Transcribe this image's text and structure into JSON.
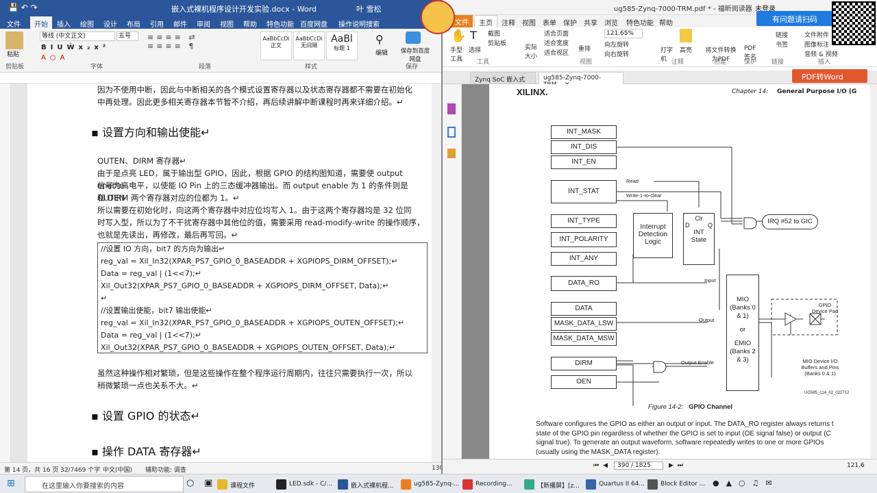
{
  "word": {
    "title": "嵌入式裸机程序设计开发实验.docx - Word",
    "user": "叶 雪松",
    "tabs": [
      "文件",
      "开始",
      "插入",
      "绘图",
      "设计",
      "布局",
      "引用",
      "邮件",
      "审阅",
      "视图",
      "帮助",
      "特色功能",
      "百度网盘",
      "操作说明搜索"
    ],
    "ribbon": {
      "font_name": "等线 (中文正文)",
      "font_size": "五号",
      "paste": "粘贴",
      "clipboard": "剪贴板",
      "font_group": "字体",
      "para_group": "段落",
      "styles_group": "样式",
      "styles": [
        {
          "sample": "AaBbCcDi",
          "name": "正文"
        },
        {
          "sample": "AaBbCcDi",
          "name": "无间隔"
        },
        {
          "sample": "AaBl",
          "name": "标题 1"
        }
      ],
      "edit": "编辑",
      "save_baidu": "保存到百度网盘",
      "save_group": "保存"
    },
    "body": {
      "intro1": "因为不使用中断，因此与中断相关的各个模式设置寄存器以及状态寄存器都不需要在初始化",
      "intro2": "中再处理。因此更多相关寄存器本节暂不介绍，再后续讲解中断课程时再来详细介绍。↵",
      "heading1": "设置方向和输出使能↵",
      "p1": "OUTEN、DIRM 寄存器↵",
      "p2a": "由于是点亮 LED，属于输出型 GPIO，因此，根据 GPIO 的结构图知道，需要使 output enable",
      "p2b": "信号为高电平，以使能 IO Pin 上的三态缓冲器输出。而 output enable 为 1 的条件则是 OUTEN",
      "p2c": "和 DIRM 两个寄存器对应的位都为 1。↵",
      "p3a": "所以需要在初始化时，向这两个寄存器中对应位均写入 1。由于这两个寄存器均是 32 位同",
      "p3b": "时写入型，所以为了不干扰寄存器中其他位的值，需要采用 read-modify-write 的操作顺序，",
      "p3c": "也就是先读出，再修改，最后再写回。↵",
      "code": [
        "//设置 IO 方向，bit7 的方向为输出↵",
        "reg_val = Xil_In32(XPAR_PS7_GPIO_0_BASEADDR + XGPIOPS_DIRM_OFFSET);↵",
        "Data = reg_val | (1<<7);↵",
        "Xil_Out32(XPAR_PS7_GPIO_0_BASEADDR + XGPIOPS_DIRM_OFFSET, Data);↵",
        "↵",
        "//设置输出使能，bit7 输出使能↵",
        "reg_val = Xil_In32(XPAR_PS7_GPIO_0_BASEADDR + XGPIOPS_OUTEN_OFFSET);↵",
        "Data = reg_val | (1<<7);↵",
        "Xil_Out32(XPAR_PS7_GPIO_0_BASEADDR + XGPIOPS_OUTEN_OFFSET, Data);↵"
      ],
      "p4a": "虽然这种操作相对繁琐，但是这些操作在整个程序运行周期内，往往只需要执行一次，所以",
      "p4b": "稍微繁琐一点也关系不大。↵",
      "heading2": "设置 GPIO 的状态↵",
      "heading3": "操作 DATA 寄存器↵"
    },
    "status": {
      "page": "第 14 页，共 16 页",
      "words": "32/7469 个字",
      "lang": "中文(中国)",
      "access": "辅助功能: 调查",
      "zoom": "130"
    }
  },
  "foxit": {
    "title": "ug585-Zynq-7000-TRM.pdf * - 福昕阅读器",
    "login": "未登录",
    "tabs": [
      "文件",
      "主页",
      "注释",
      "视图",
      "表单",
      "保护",
      "共享",
      "浏览",
      "特色功能",
      "帮助"
    ],
    "ribbon": {
      "hand": "手型工具",
      "select": "选择",
      "screenshot": "截图",
      "clipboard": "剪贴板",
      "actual_size": "实际大小",
      "fit_page": "适合页面",
      "fit_width": "适合宽度",
      "fit_visible": "适合视区",
      "reflow": "重排",
      "zoom": "121.65%",
      "rotate_left": "向左旋转",
      "rotate_right": "向右旋转",
      "typewriter": "打字机",
      "highlight": "高亮",
      "to_pdf": "将文件转换为PDF",
      "pdf_sign": "PDF签名",
      "link": "链接",
      "bookmark": "书签",
      "attach": "文件附件",
      "image_note": "图像标注",
      "audio": "音频 & 视频",
      "groups": [
        "工具",
        "视图",
        "注释",
        "创建",
        "保护",
        "链接",
        "插入"
      ]
    },
    "doctabs": [
      "Zynq SoC 嵌入式设计...",
      "ug585-Zynq-7000-TRM..."
    ],
    "pdf": {
      "logo": "XILINX.",
      "chapter": "Chapter 14:",
      "chapter_title": "General Purpose I/O (G",
      "boxes": {
        "int_mask": "INT_MASK",
        "int_dis": "INT_DIS",
        "int_en": "INT_EN",
        "int_stat": "INT_STAT",
        "int_type": "INT_TYPE",
        "int_polarity": "INT_POLARITY",
        "int_any": "INT_ANY",
        "data_ro": "DATA_RO",
        "data": "DATA",
        "mask_lsw": "MASK_DATA_LSW",
        "mask_msw": "MASK_DATA_MSW",
        "dirm": "DIRM",
        "oen": "OEN",
        "irq": "IRQ #52 to GIC",
        "detect": "Interrupt Detection Logic",
        "mio": "MIO (Banks 0 & 1)",
        "or": "or",
        "emio": "EMIO (Banks 2 & 3)",
        "clr": "Clr",
        "d": "D",
        "q": "Q",
        "int_state": "INT State"
      },
      "labels": {
        "read": "Read",
        "w1c": "Write-1-to-clear",
        "input": "Input",
        "output": "Output",
        "oe": "Output Enable",
        "pad": "GPIO Device Pad",
        "mio_io": "MIO Device I/O Buffers and Pins (Banks 0 & 1)",
        "id": "UG585_c14_02_022712"
      },
      "caption_num": "Figure 14-2:",
      "caption": "GPIO Channel",
      "text": [
        "Software configures the GPIO as either an output or input. The DATA_RO register always returns t",
        "state of the GPIO pin regardless of whether the GPIO is set to input (OE signal false) or output (C",
        "signal true). To generate an output waveform, software repeatedly writes to one or more GPIOs",
        "(usually using the MASK_DATA register)."
      ]
    },
    "status": {
      "page": "390 / 1825",
      "zoom": "121.6"
    }
  },
  "overlay": {
    "ask": "有问题请扫码",
    "pdf2word": "PDF转Word"
  },
  "taskbar": {
    "search": "在这里输入你要搜索的内容",
    "items": [
      {
        "label": "课程文件",
        "color": "#e8b92f"
      },
      {
        "label": "LED.sdk - C/...",
        "color": "#222"
      },
      {
        "label": "嵌入式裸机程...",
        "color": "#2b579a"
      },
      {
        "label": "ug585-Zynq-...",
        "color": "#e8801f"
      },
      {
        "label": "Recording...",
        "color": "#d33"
      },
      {
        "label": "【新播屏】[z...",
        "color": "#3a8"
      },
      {
        "label": "Quartus II 64...",
        "color": "#36a"
      },
      {
        "label": "Block Editor ...",
        "color": "#555"
      }
    ]
  }
}
